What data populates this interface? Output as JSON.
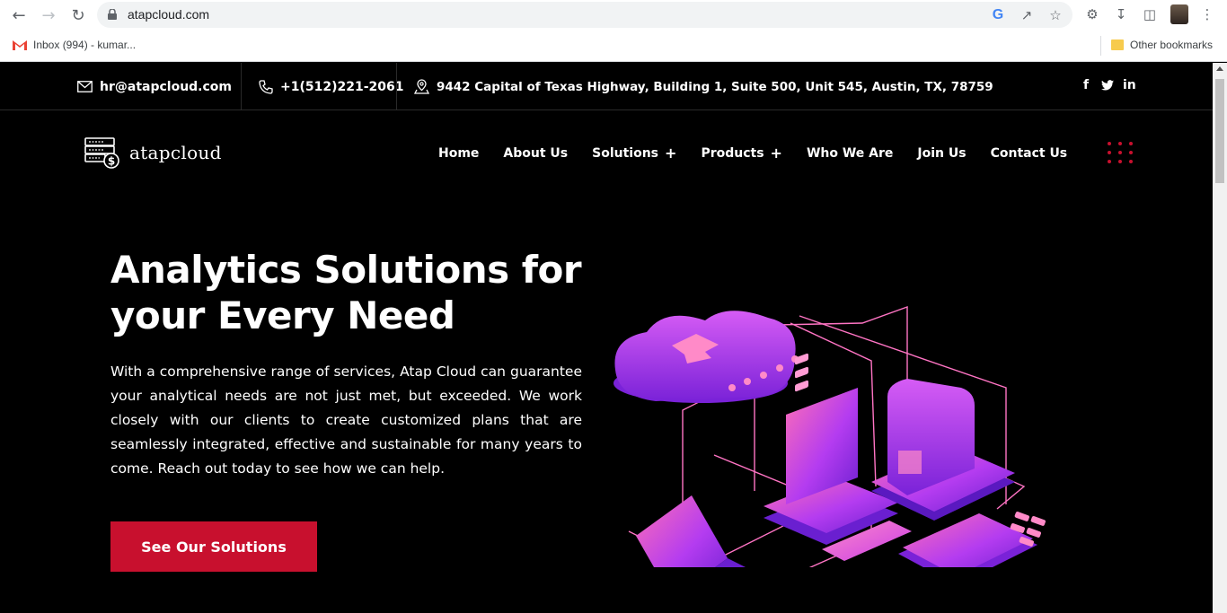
{
  "browser": {
    "url": "atapcloud.com",
    "bookmarks": [
      {
        "label": "Inbox (994) - kumar..."
      },
      {
        "label": "Other bookmarks"
      }
    ]
  },
  "topbar": {
    "email": "hr@atapcloud.com",
    "phone": "+1(512)221-2061",
    "address": "9442 Capital of Texas Highway, Building 1, Suite 500, Unit 545, Austin, TX, 78759",
    "social": {
      "facebook": "f",
      "linkedin": "in"
    }
  },
  "header": {
    "logo_text": "atapcloud",
    "menu": [
      {
        "label": "Home",
        "has_submenu": false
      },
      {
        "label": "About Us",
        "has_submenu": false
      },
      {
        "label": "Solutions",
        "has_submenu": true
      },
      {
        "label": "Products",
        "has_submenu": true
      },
      {
        "label": "Who We Are",
        "has_submenu": false
      },
      {
        "label": "Join Us",
        "has_submenu": false
      },
      {
        "label": "Contact Us",
        "has_submenu": false
      }
    ],
    "submenu_symbol": "+"
  },
  "hero": {
    "title_line1": "Analytics Solutions for",
    "title_line2": "your Every Need",
    "text": "With a comprehensive range of services, Atap Cloud can guarantee your analytical needs are not just met, but exceeded. We work closely with our clients to create customized plans that are seamlessly integrated, effective and sustainable for many years to come. Reach out today to see how we can help.",
    "cta_label": "See Our Solutions"
  },
  "colors": {
    "accent": "#c8102e",
    "background": "#000000",
    "illustration_purple": "#8a2be2",
    "illustration_pink": "#ff5fa8"
  }
}
